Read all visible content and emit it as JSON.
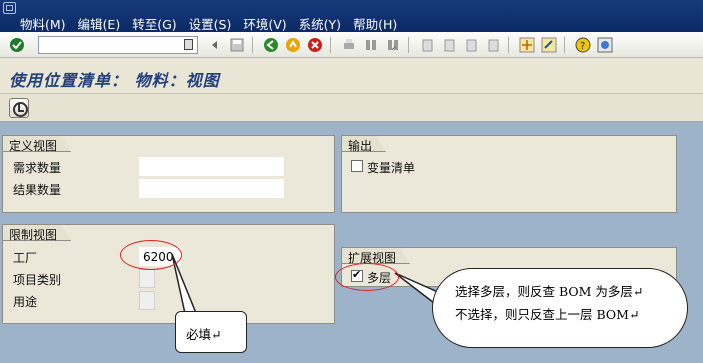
{
  "menubar": {
    "items": [
      "物料(M)",
      "编辑(E)",
      "转至(G)",
      "设置(S)",
      "环境(V)",
      "系统(Y)",
      "帮助(H)"
    ]
  },
  "toolbar": {
    "command_value": "",
    "icons": [
      "enter-check",
      "command-history",
      "back-arrow",
      "save-disk",
      "back-green",
      "exit-yellow",
      "cancel-red",
      "print",
      "find",
      "find-next",
      "first-page",
      "prev-page",
      "next-page",
      "last-page",
      "create-session",
      "shortcut",
      "help",
      "customize"
    ]
  },
  "title": "使用位置清单： 物料：视图",
  "groups": {
    "definition": {
      "title": "定义视图",
      "rows": [
        {
          "label": "需求数量",
          "value": ""
        },
        {
          "label": "结果数量",
          "value": ""
        }
      ]
    },
    "output": {
      "title": "输出",
      "checkbox_label": "变量清单",
      "checked": false
    },
    "restriction": {
      "title": "限制视图",
      "rows": [
        {
          "label": "工厂",
          "value": "6200"
        },
        {
          "label": "项目类别",
          "value": ""
        },
        {
          "label": "用途",
          "value": ""
        }
      ]
    },
    "extended": {
      "title": "扩展视图",
      "checkbox_label": "多层",
      "checked": true
    }
  },
  "annotations": {
    "required": "必填↵",
    "multilevel_line1": "选择多层，则反查 BOM 为多层↵",
    "multilevel_line2": "不选择，则只反查上一层 BOM↵",
    "ring_color": "#e02020"
  }
}
